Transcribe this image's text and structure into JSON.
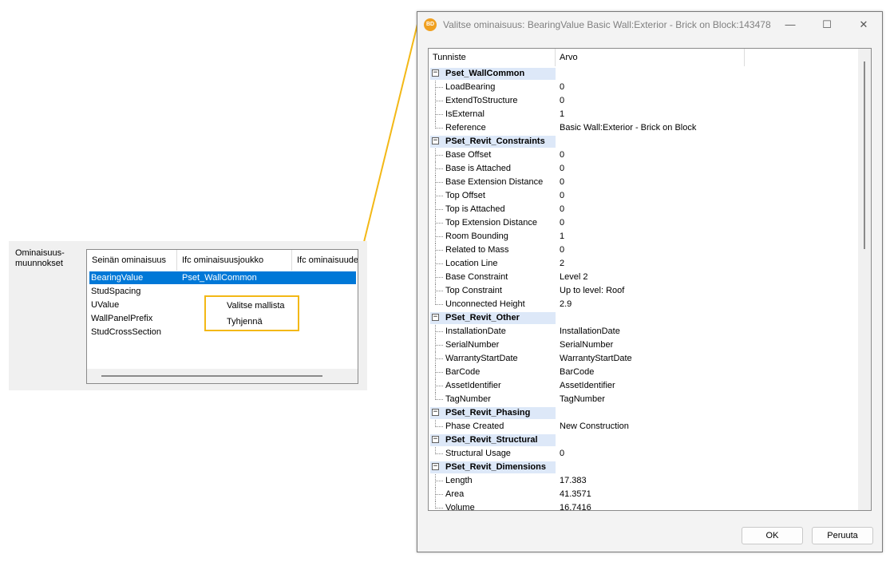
{
  "left_panel": {
    "label": "Ominaisuus-\nmuunnokset",
    "columns": [
      "Seinän ominaisuus",
      "Ifc ominaisuusjoukko",
      "Ifc ominaisuude"
    ],
    "rows": [
      {
        "property": "BearingValue",
        "pset": "Pset_WallCommon",
        "selected": true
      },
      {
        "property": "StudSpacing",
        "pset": ""
      },
      {
        "property": "UValue",
        "pset": ""
      },
      {
        "property": "WallPanelPrefix",
        "pset": ""
      },
      {
        "property": "StudCrossSection",
        "pset": ""
      }
    ],
    "context_menu": [
      "Valitse mallista",
      "Tyhjennä"
    ]
  },
  "dialog": {
    "app_icon_text": "BD",
    "title": "Valitse ominaisuus: BearingValue Basic Wall:Exterior - Brick on Block:143478",
    "minimize_glyph": "—",
    "maximize_glyph": "☐",
    "close_glyph": "✕",
    "columns": [
      "Tunniste",
      "Arvo"
    ],
    "groups": [
      {
        "name": "Pset_WallCommon",
        "toggle": "−",
        "items": [
          {
            "name": "LoadBearing",
            "value": "0"
          },
          {
            "name": "ExtendToStructure",
            "value": "0"
          },
          {
            "name": "IsExternal",
            "value": "1"
          },
          {
            "name": "Reference",
            "value": "Basic Wall:Exterior - Brick on Block"
          }
        ]
      },
      {
        "name": "PSet_Revit_Constraints",
        "toggle": "−",
        "items": [
          {
            "name": "Base Offset",
            "value": "0"
          },
          {
            "name": "Base is Attached",
            "value": "0"
          },
          {
            "name": "Base Extension Distance",
            "value": "0"
          },
          {
            "name": "Top Offset",
            "value": "0"
          },
          {
            "name": "Top is Attached",
            "value": "0"
          },
          {
            "name": "Top Extension Distance",
            "value": "0"
          },
          {
            "name": "Room Bounding",
            "value": "1"
          },
          {
            "name": "Related to Mass",
            "value": "0"
          },
          {
            "name": "Location Line",
            "value": "2"
          },
          {
            "name": "Base Constraint",
            "value": "Level 2"
          },
          {
            "name": "Top Constraint",
            "value": "Up to level: Roof"
          },
          {
            "name": "Unconnected Height",
            "value": "2.9"
          }
        ]
      },
      {
        "name": "PSet_Revit_Other",
        "toggle": "−",
        "items": [
          {
            "name": "InstallationDate",
            "value": "InstallationDate"
          },
          {
            "name": "SerialNumber",
            "value": "SerialNumber"
          },
          {
            "name": "WarrantyStartDate",
            "value": "WarrantyStartDate"
          },
          {
            "name": "BarCode",
            "value": "BarCode"
          },
          {
            "name": "AssetIdentifier",
            "value": "AssetIdentifier"
          },
          {
            "name": "TagNumber",
            "value": "TagNumber"
          }
        ]
      },
      {
        "name": "PSet_Revit_Phasing",
        "toggle": "−",
        "items": [
          {
            "name": "Phase Created",
            "value": "New Construction"
          }
        ]
      },
      {
        "name": "PSet_Revit_Structural",
        "toggle": "−",
        "items": [
          {
            "name": "Structural Usage",
            "value": "0"
          }
        ]
      },
      {
        "name": "PSet_Revit_Dimensions",
        "toggle": "−",
        "items": [
          {
            "name": "Length",
            "value": "17.383"
          },
          {
            "name": "Area",
            "value": "41.3571"
          },
          {
            "name": "Volume",
            "value": "16.7416"
          }
        ]
      }
    ],
    "ok_label": "OK",
    "cancel_label": "Peruuta"
  },
  "colors": {
    "highlight": "#f3b816",
    "selection": "#0078d7",
    "group_band": "#dde8f8"
  }
}
